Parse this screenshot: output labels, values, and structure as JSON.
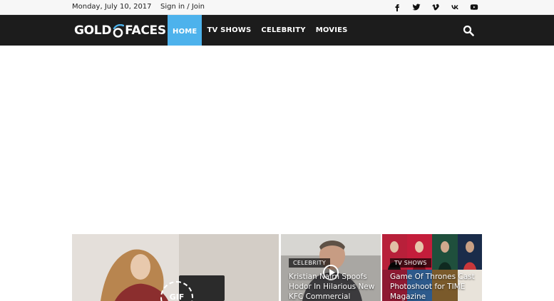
{
  "topbar": {
    "date": "Monday, July 10, 2017",
    "signin": "Sign in / Join",
    "social": [
      "facebook-icon",
      "twitter-icon",
      "vimeo-icon",
      "vk-icon",
      "youtube-icon"
    ]
  },
  "header": {
    "logo_left": "GOLD",
    "logo_right": "FACES",
    "nav": [
      {
        "label": "HOME",
        "active": true
      },
      {
        "label": "TV SHOWS",
        "active": false
      },
      {
        "label": "CELEBRITY",
        "active": false
      },
      {
        "label": "MOVIES",
        "active": false
      }
    ],
    "search_icon": "search-icon"
  },
  "featured": [
    {
      "category": "",
      "title": "",
      "badge": "GIF"
    },
    {
      "category": "CELEBRITY",
      "title": "Kristian Nairn Spoofs Hodor In Hilarious New KFC Commercial"
    },
    {
      "category": "TV SHOWS",
      "title": "Game Of Thrones Cast Photoshoot for TIME Magazine"
    }
  ],
  "colors": {
    "topbar_bg": "#f7f7f7",
    "nav_bg": "#1c1c1c",
    "accent": "#4db2ec"
  }
}
